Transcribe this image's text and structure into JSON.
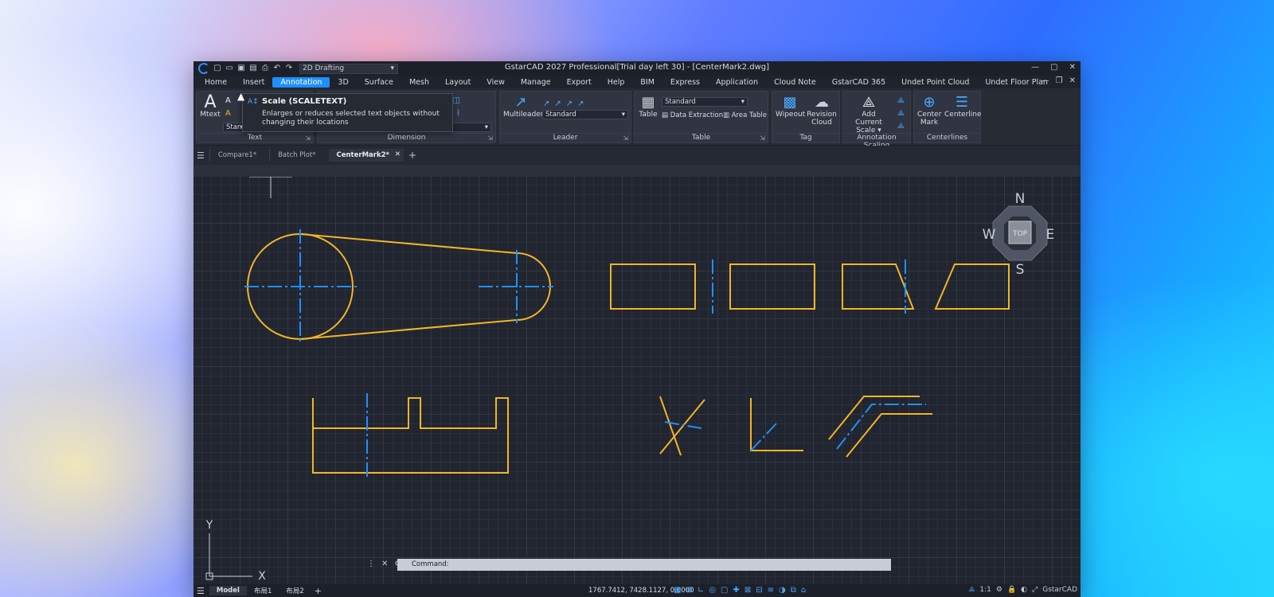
{
  "window": {
    "title": "GstarCAD 2027 Professional[Trial day left 30] - [CenterMark2.dwg]",
    "workspace": "2D Drafting"
  },
  "menu": [
    "Home",
    "Insert",
    "Annotation",
    "3D",
    "Surface",
    "Mesh",
    "Layout",
    "View",
    "Manage",
    "Export",
    "Help",
    "BIM",
    "Express",
    "Application",
    "Cloud Note",
    "GstarCAD 365",
    "Undet Point Cloud",
    "Undet Floor Plan"
  ],
  "menu_active": "Annotation",
  "ribbon": {
    "text": {
      "label": "Text",
      "mtext": "Mtext",
      "style": "Stand"
    },
    "dimension": {
      "label": "Dimension"
    },
    "leader": {
      "label": "Leader",
      "multileader": "Multileader",
      "style": "Standard"
    },
    "table": {
      "label": "Table",
      "table": "Table",
      "style": "Standard",
      "data_extraction": "Data Extraction",
      "area_table": "Area Table"
    },
    "tag": {
      "label": "Tag",
      "wipeout": "Wipeout",
      "revision": "Revision",
      "cloud": "Cloud"
    },
    "annotation_scaling": {
      "label": "Annotation Scaling",
      "add": "Add",
      "current_scale": "Current Scale ▾"
    },
    "centerlines": {
      "label": "Centerlines",
      "center": "Center",
      "mark": "Mark",
      "centerline": "Centerline"
    }
  },
  "tooltip": {
    "title": "Scale (SCALETEXT)",
    "description": "Enlarges or reduces selected text objects without changing their locations"
  },
  "doc_tabs": [
    "Compare1*",
    "Batch Plot*",
    "CenterMark2*"
  ],
  "viewcube": {
    "top": "TOP",
    "n": "N",
    "s": "S",
    "e": "E",
    "w": "W"
  },
  "ucs": {
    "x": "X",
    "y": "Y"
  },
  "command": {
    "prompt": "Command:"
  },
  "status": {
    "tabs": [
      "Model",
      "布局1",
      "布局2"
    ],
    "coordinates": "1767.7412, 7428.1127, 0.0000",
    "scale": "1:1",
    "app": "GstarCAD"
  },
  "colors": {
    "geometry": "#f2b527",
    "centerline": "#1e90ff",
    "accent": "#1e8fff"
  }
}
